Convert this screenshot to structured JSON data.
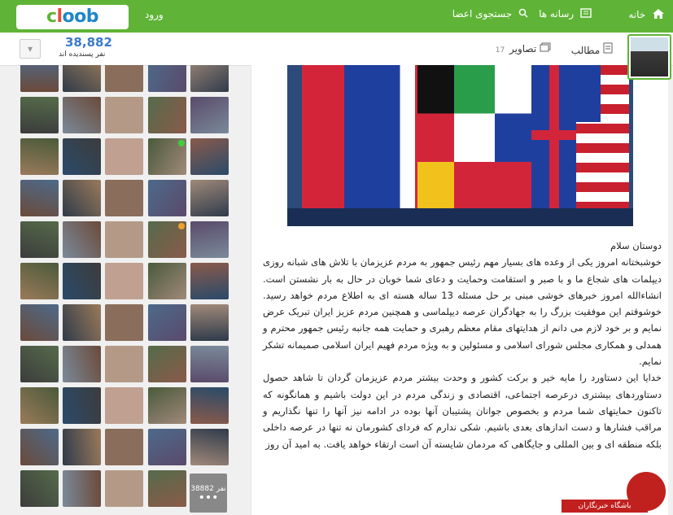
{
  "header": {
    "logo": "cloob",
    "login": "ورود",
    "nav": {
      "home": "خانه",
      "media": "رسانه ها",
      "search": "جستجوی اعضا"
    }
  },
  "subbar": {
    "likes_count": "38,882",
    "likes_label": "نفر پسندیده اند",
    "tabs": {
      "posts": "مطالب",
      "photos": "تصاویر",
      "photos_count": "17"
    }
  },
  "sidebar": {
    "more_count": "38882 نفر",
    "more_dots": "•••"
  },
  "post": {
    "paragraphs": [
      "دوستان سلام",
      "خوشبختانه امروز یکی از وعده های بسیار مهم رئیس جمهور به مردم عزیزمان با تلاش های شبانه روزی دیپلمات های شجاع ما و با صبر و استقامت وحمایت و دعای شما خوبان در حال به بار نشستن است. انشاءالله امروز خبرهای خوشی مبنی بر حل مسئله 13 ساله هسته ای به اطلاع مردم خواهد رسید. خوشوقتم این موفقیت بزرگ را به جهادگران عرصه دیپلماسی و همچنین مردم عزیز ایران تبریک عرض نمایم و بر خود لازم می دانم از هدایتهای مقام معظم رهبری و حمایت همه جانبه رئیس جمهور محترم و همدلی و همکاری مجلس شورای اسلامی و مسئولین و به ویژه مردم فهیم ایران اسلامی صمیمانه تشکر نمایم.",
      "خدایا این دستاورد را مایه خیر و برکت کشور و وحدت بیشتر مردم عزیزمان گردان تا شاهد حصول دستاوردهای بیشتری درعرصه اجتماعی، اقتصادی و زندگی مردم در این دولت باشیم و همانگونه که تاکنون حمایتهای شما مردم و بخصوص جوانان پشتیبان آنها بوده در ادامه نیز آنها را تنها نگذاریم و مراقب فشارها و دست اندازهای بعدی باشیم. شکی ندارم که فردای کشورمان نه تنها در عرصه داخلی بلکه منطقه ای و بین المللی و جایگاهی که مردمان شایسته آن است ارتقاء خواهد یافت. به امید آن روز"
    ]
  },
  "watermark": {
    "label": "باشگاه خبرنگاران"
  },
  "colors": {
    "brand_green": "#5fb437",
    "link_blue": "#3a7bc8",
    "watermark_red": "#c0201e"
  }
}
